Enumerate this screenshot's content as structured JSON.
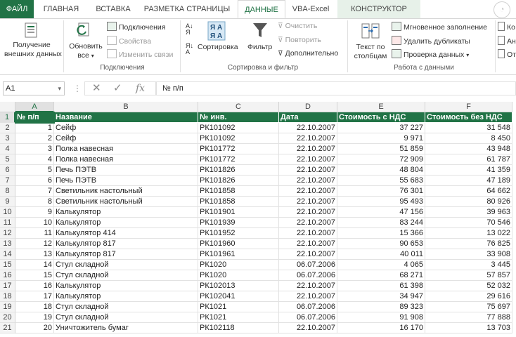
{
  "tabs": [
    {
      "label": "ФАЙЛ",
      "kind": "file"
    },
    {
      "label": "ГЛАВНАЯ",
      "kind": ""
    },
    {
      "label": "ВСТАВКА",
      "kind": ""
    },
    {
      "label": "РАЗМЕТКА СТРАНИЦЫ",
      "kind": ""
    },
    {
      "label": "ДАННЫЕ",
      "kind": "active"
    },
    {
      "label": "VBA-Excel",
      "kind": ""
    },
    {
      "label": "КОНСТРУКТОР",
      "kind": "ctx"
    }
  ],
  "ribbon": {
    "get_external": {
      "line1": "Получение",
      "line2": "внешних данных"
    },
    "refresh_all": {
      "line1": "Обновить",
      "line2": "все"
    },
    "connections": "Подключения",
    "properties": "Свойства",
    "edit_links": "Изменить связи",
    "group_connections": "Подключения",
    "sort": "Сортировка",
    "filter": "Фильтр",
    "clear": "Очистить",
    "reapply": "Повторить",
    "advanced": "Дополнительно",
    "group_sort_filter": "Сортировка и фильтр",
    "text_to_columns": {
      "line1": "Текст по",
      "line2": "столбцам"
    },
    "flash_fill": "Мгновенное заполнение",
    "remove_duplicates": "Удалить дубликаты",
    "data_validation": "Проверка данных",
    "group_data_tools": "Работа с данными",
    "cut_1": "Ко",
    "cut_2": "Ан",
    "cut_3": "От"
  },
  "formula_bar": {
    "name_box": "A1",
    "formula": "№ п/п",
    "fx": "fx"
  },
  "sheet": {
    "columns": [
      "A",
      "B",
      "C",
      "D",
      "E",
      "F"
    ],
    "header_row": [
      "№ п/п",
      "Название",
      "№ инв.",
      "Дата",
      "Стоимость с НДС",
      "Стоимость без НДС"
    ],
    "rows": [
      [
        "1",
        "Сейф",
        "РК101092",
        "22.10.2007",
        "37 227",
        "31 548"
      ],
      [
        "2",
        "Сейф",
        "РК101092",
        "22.10.2007",
        "9 971",
        "8 450"
      ],
      [
        "3",
        "Полка навесная",
        "РК101772",
        "22.10.2007",
        "51 859",
        "43 948"
      ],
      [
        "4",
        "Полка навесная",
        "РК101772",
        "22.10.2007",
        "72 909",
        "61 787"
      ],
      [
        "5",
        "Печь ПЭТВ",
        "РК101826",
        "22.10.2007",
        "48 804",
        "41 359"
      ],
      [
        "6",
        "Печь ПЭТВ",
        "РК101826",
        "22.10.2007",
        "55 683",
        "47 189"
      ],
      [
        "7",
        "Светильник настольный",
        "РК101858",
        "22.10.2007",
        "76 301",
        "64 662"
      ],
      [
        "8",
        "Светильник настольный",
        "РК101858",
        "22.10.2007",
        "95 493",
        "80 926"
      ],
      [
        "9",
        "Калькулятор",
        "РК101901",
        "22.10.2007",
        "47 156",
        "39 963"
      ],
      [
        "10",
        "Калькулятор",
        "РК101939",
        "22.10.2007",
        "83 244",
        "70 546"
      ],
      [
        "11",
        "Калькулятор 414",
        "РК101952",
        "22.10.2007",
        "15 366",
        "13 022"
      ],
      [
        "12",
        "Калькулятор 817",
        "РК101960",
        "22.10.2007",
        "90 653",
        "76 825"
      ],
      [
        "13",
        "Калькулятор 817",
        "РК101961",
        "22.10.2007",
        "40 011",
        "33 908"
      ],
      [
        "14",
        "Стул складной",
        "РК1020",
        "06.07.2006",
        "4 065",
        "3 445"
      ],
      [
        "15",
        "Стул складной",
        "РК1020",
        "06.07.2006",
        "68 271",
        "57 857"
      ],
      [
        "16",
        "Калькулятор",
        "РК102013",
        "22.10.2007",
        "61 398",
        "52 032"
      ],
      [
        "17",
        "Калькулятор",
        "РК102041",
        "22.10.2007",
        "34 947",
        "29 616"
      ],
      [
        "18",
        "Стул складной",
        "РК1021",
        "06.07.2006",
        "89 323",
        "75 697"
      ],
      [
        "19",
        "Стул складной",
        "РК1021",
        "06.07.2006",
        "91 908",
        "77 888"
      ],
      [
        "20",
        "Уничтожитель бумаг",
        "РК102118",
        "22.10.2007",
        "16 170",
        "13 703"
      ]
    ]
  },
  "colors": {
    "excel_green": "#217346"
  }
}
